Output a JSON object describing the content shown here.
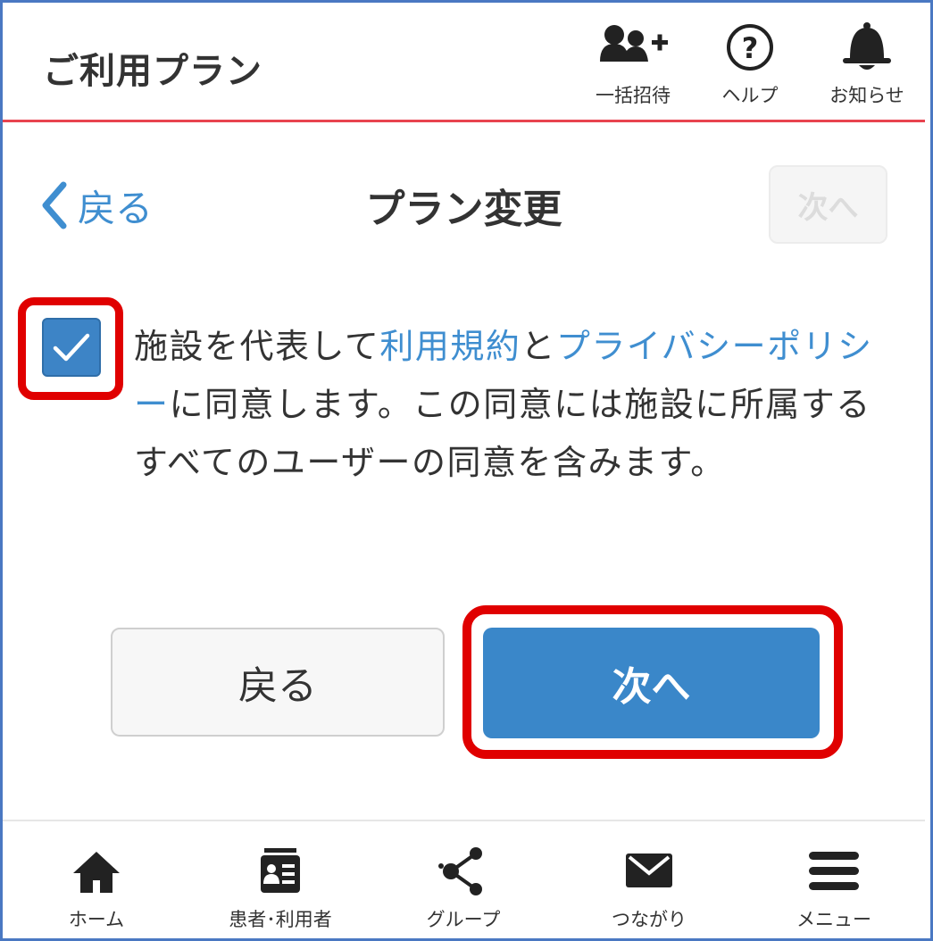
{
  "header": {
    "title": "ご利用プラン",
    "actions": [
      {
        "label": "一括招待",
        "icon": "add-users-icon"
      },
      {
        "label": "ヘルプ",
        "icon": "help-icon"
      },
      {
        "label": "お知らせ",
        "icon": "bell-icon"
      }
    ]
  },
  "subheader": {
    "back_label": "戻る",
    "title": "プラン変更",
    "next_label": "次へ"
  },
  "agreement": {
    "checked": true,
    "text_1": "施設を代表して",
    "terms_link": "利用規約",
    "text_2": "と",
    "privacy_link": "プライバシーポリシー",
    "text_3": "に同意します。この同意には施設に所属するすべてのユーザーの同意を含みます。"
  },
  "buttons": {
    "back": "戻る",
    "next": "次へ"
  },
  "bottom_nav": [
    {
      "label": "ホーム",
      "icon": "home-icon"
    },
    {
      "label": "患者･利用者",
      "icon": "id-card-icon"
    },
    {
      "label": "グループ",
      "icon": "share-nodes-icon"
    },
    {
      "label": "つながり",
      "icon": "envelope-icon"
    },
    {
      "label": "メニュー",
      "icon": "hamburger-menu-icon"
    }
  ],
  "colors": {
    "accent": "#3a87c9",
    "link": "#3f8ed0",
    "header_rule": "#e8434f",
    "highlight": "#e00000"
  }
}
